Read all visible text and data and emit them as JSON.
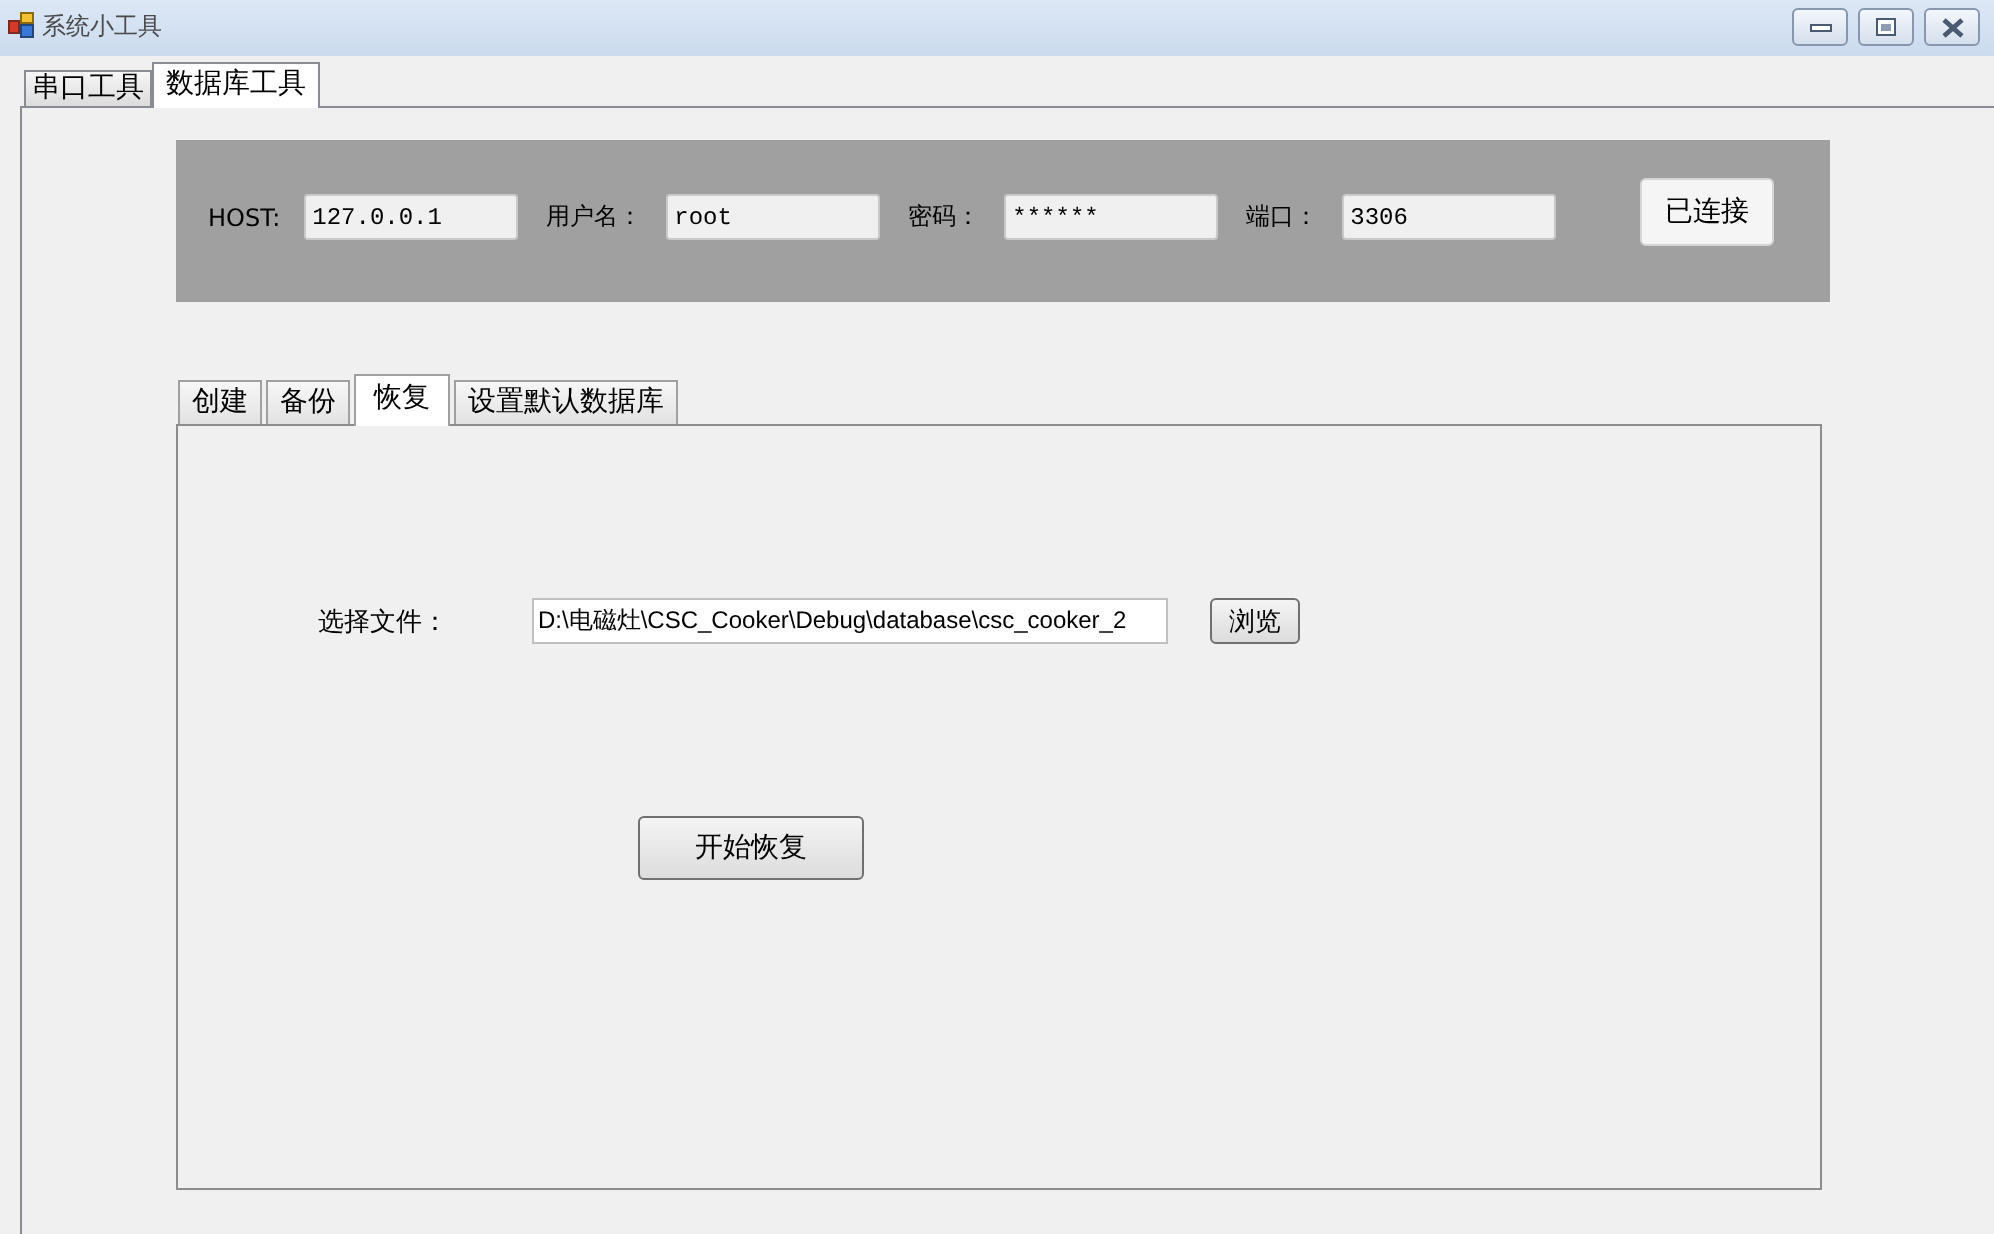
{
  "window": {
    "title": "系统小工具"
  },
  "tabs": [
    {
      "label": "串口工具",
      "selected": false
    },
    {
      "label": "数据库工具",
      "selected": true
    }
  ],
  "connection": {
    "fields": [
      {
        "label": "HOST:",
        "value": "127.0.0.1"
      },
      {
        "label": "用户名：",
        "value": "root"
      },
      {
        "label": "密码：",
        "value": "******"
      },
      {
        "label": "端口：",
        "value": "3306"
      }
    ],
    "connect_button": "已连接"
  },
  "database_tabs": [
    {
      "label": "创建",
      "selected": false
    },
    {
      "label": "备份",
      "selected": false
    },
    {
      "label": "恢复",
      "selected": true
    },
    {
      "label": "设置默认数据库",
      "selected": false
    }
  ],
  "restore": {
    "file_label": "选择文件：",
    "file_path": "D:\\电磁灶\\CSC_Cooker\\Debug\\database\\csc_cooker_2",
    "browse_button": "浏览",
    "start_button": "开始恢复"
  }
}
